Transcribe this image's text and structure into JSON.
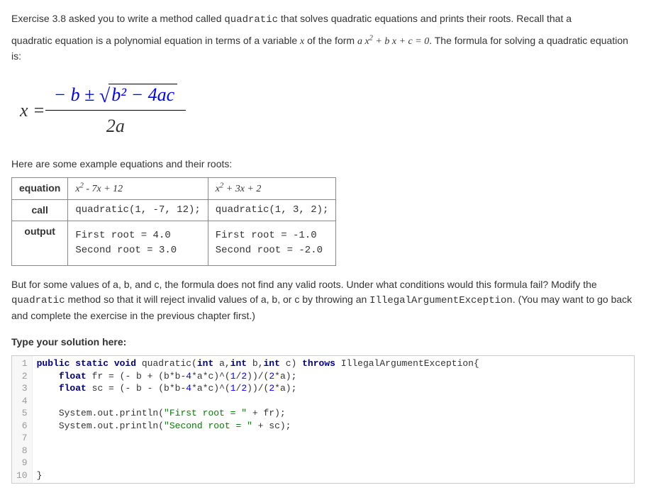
{
  "intro": {
    "p1_a": "Exercise 3.8 asked you to write a method called ",
    "p1_code": "quadratic",
    "p1_b": " that solves quadratic equations and prints their roots. Recall that a",
    "p2_a": "quadratic equation is a polynomial equation in terms of a variable ",
    "p2_var": "x",
    "p2_b": " of the form ",
    "p2_eq_a": "a x",
    "p2_eq_sup": "2",
    "p2_eq_b": " + b x + c = 0",
    "p2_c": ". The formula for solving a quadratic equation is:"
  },
  "formula": {
    "lhs": "x =",
    "num_text": "− b ± ",
    "sqrt_inner": "b² − 4ac",
    "den": "2a"
  },
  "examples_intro": "Here are some example equations and their roots:",
  "table": {
    "headers": {
      "equation": "equation",
      "call": "call",
      "output": "output"
    },
    "col1": {
      "eq_a": "x",
      "eq_sup": "2",
      "eq_b": " - 7x + 12",
      "call": "quadratic(1, -7, 12);",
      "output": "First root = 4.0\nSecond root = 3.0"
    },
    "col2": {
      "eq_a": "x",
      "eq_sup": "2",
      "eq_b": " + 3x + 2",
      "call": "quadratic(1, 3, 2);",
      "output": "First root = -1.0\nSecond root = -2.0"
    }
  },
  "followup": {
    "p1_a": "But for some values of a, b, and c, the formula does not find any valid roots. Under what conditions would this formula fail? Modify the ",
    "p1_code": "quadratic",
    "p1_b": " method so that it will reject invalid values of a, b, or c by throwing an ",
    "p1_code2": "IllegalArgumentException",
    "p1_c": ". (You may want to go back and complete the exercise in the previous chapter first.)"
  },
  "solution_label": "Type your solution here:",
  "code": {
    "line_numbers": "1\n2\n3\n4\n5\n6\n7\n8\n9\n10",
    "l1_a": "public static void",
    "l1_b": " quadratic(",
    "l1_c": "int",
    "l1_d": " a,",
    "l1_e": "int",
    "l1_f": " b,",
    "l1_g": "int",
    "l1_h": " c) ",
    "l1_i": "throws",
    "l1_j": " IllegalArgumentException{",
    "l2_a": "    ",
    "l2_b": "float",
    "l2_c": " fr = (- b + (b*b-",
    "l2_n1": "4",
    "l2_d": "*a*c)^(",
    "l2_n2": "1",
    "l2_e": "/",
    "l2_n3": "2",
    "l2_f": "))/(",
    "l2_n4": "2",
    "l2_g": "*a);",
    "l3_a": "    ",
    "l3_b": "float",
    "l3_c": " sc = (- b - (b*b-",
    "l3_n1": "4",
    "l3_d": "*a*c)^(",
    "l3_n2": "1",
    "l3_e": "/",
    "l3_n3": "2",
    "l3_f": "))/(",
    "l3_n4": "2",
    "l3_g": "*a);",
    "l5_a": "    System.out.println(",
    "l5_s": "\"First root = \"",
    "l5_b": " + fr);",
    "l6_a": "    System.out.println(",
    "l6_s": "\"Second root = \"",
    "l6_b": " + sc);",
    "l10": "}"
  }
}
